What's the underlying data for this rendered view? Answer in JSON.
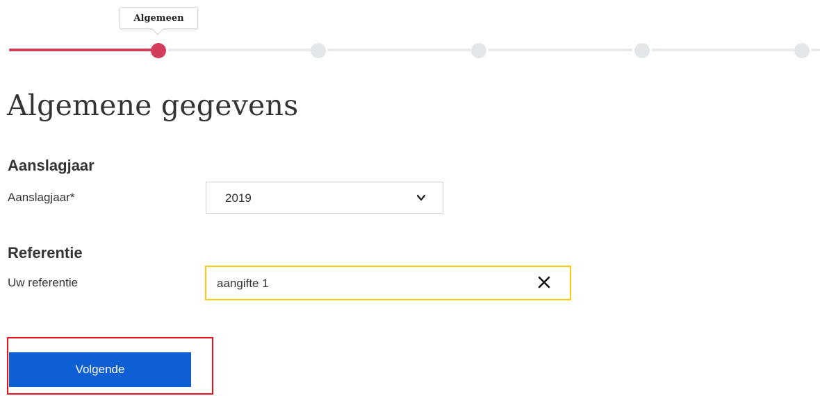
{
  "stepper": {
    "current_step_label": "Algemeen",
    "total_steps": 6,
    "current_step_index": 1,
    "active_color": "#d13d5b",
    "inactive_color": "#e4e7ea"
  },
  "main": {
    "title": "Algemene gegevens"
  },
  "sections": {
    "aanslagjaar": {
      "heading": "Aanslagjaar",
      "label": "Aanslagjaar*",
      "selected_value": "2019"
    },
    "referentie": {
      "heading": "Referentie",
      "label": "Uw referentie",
      "value": "aangifte 1",
      "focus_color": "#ffc515"
    }
  },
  "actions": {
    "next_label": "Volgende",
    "next_color": "#0e5ed4",
    "highlight_color": "#e5131d"
  },
  "icons": {
    "select": "chevron-down-icon",
    "clear": "close-icon"
  }
}
